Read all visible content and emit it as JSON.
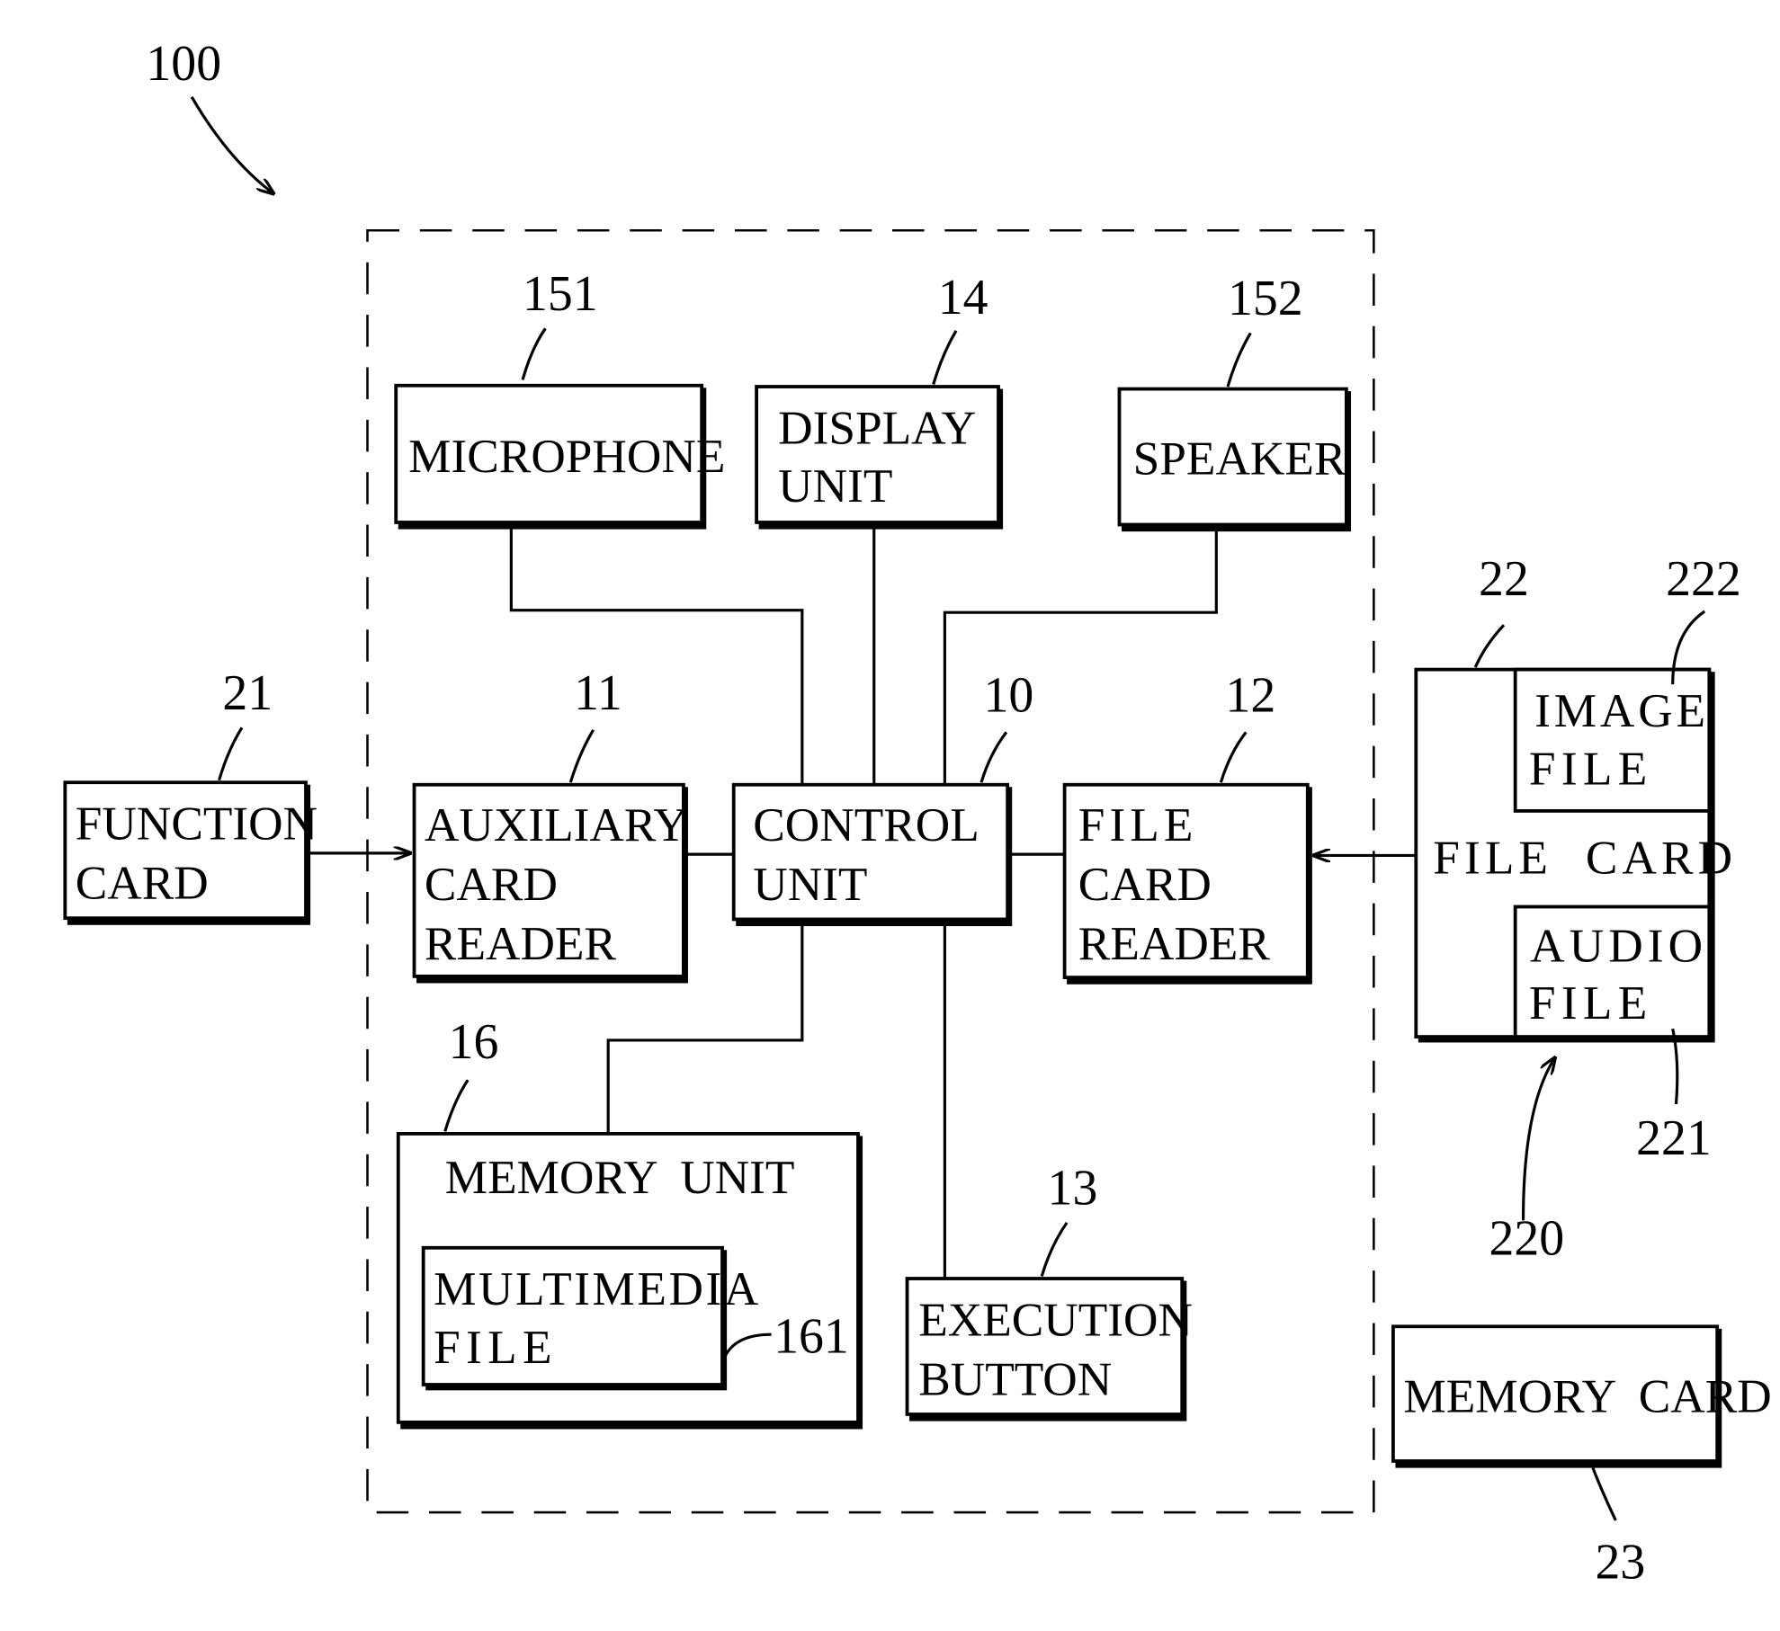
{
  "figure": {
    "reference": "100",
    "system_boundary_label": ""
  },
  "blocks": {
    "microphone": {
      "ref": "151",
      "lines": [
        "MICROPHONE"
      ]
    },
    "display_unit": {
      "ref": "14",
      "lines": [
        "DISPLAY",
        "UNIT"
      ]
    },
    "speaker": {
      "ref": "152",
      "lines": [
        "SPEAKER"
      ]
    },
    "function_card": {
      "ref": "21",
      "lines": [
        "FUNCTION",
        "CARD"
      ]
    },
    "auxiliary_card_reader": {
      "ref": "11",
      "lines": [
        "AUXILIARY",
        "CARD",
        "READER"
      ]
    },
    "control_unit": {
      "ref": "10",
      "lines": [
        "CONTROL",
        "UNIT"
      ]
    },
    "file_card_reader": {
      "ref": "12",
      "lines": [
        "FILE",
        "CARD",
        "READER"
      ]
    },
    "file_card": {
      "ref": "22",
      "lines": [
        "FILE  CARD"
      ],
      "group_ref": "220"
    },
    "image_file": {
      "ref": "222",
      "lines": [
        "IMAGE",
        "FILE"
      ]
    },
    "audio_file": {
      "ref": "221",
      "lines": [
        "AUDIO",
        "FILE"
      ]
    },
    "memory_unit": {
      "ref": "16",
      "lines": [
        "MEMORY  UNIT"
      ]
    },
    "multimedia_file": {
      "ref": "161",
      "lines": [
        "MULTIMEDIA",
        "FILE"
      ]
    },
    "execution_button": {
      "ref": "13",
      "lines": [
        "EXECUTION",
        "BUTTON"
      ]
    },
    "memory_card": {
      "ref": "23",
      "lines": [
        "MEMORY  CARD"
      ]
    }
  }
}
